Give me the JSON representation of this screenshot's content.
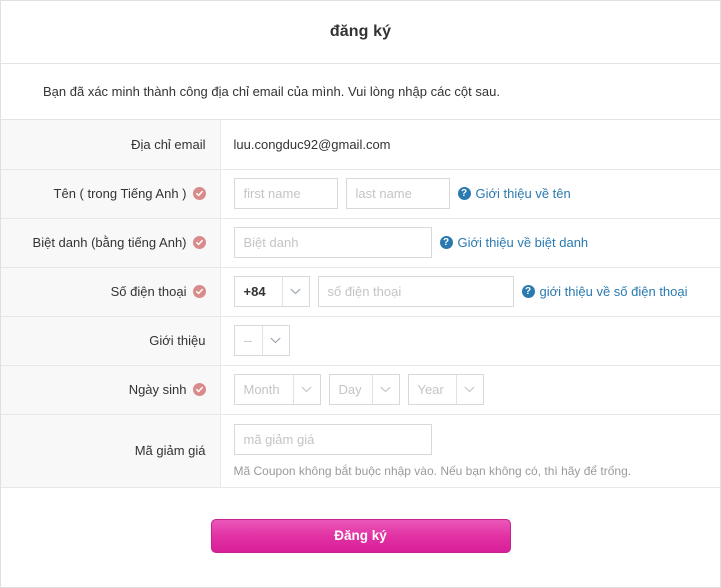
{
  "header": {
    "title": "đăng ký"
  },
  "notice": {
    "text": "Bạn đã xác minh thành công địa chỉ email của mình. Vui lòng nhập các cột sau."
  },
  "form": {
    "rows": {
      "email": {
        "label": "Địa chỉ email",
        "value": "luu.congduc92@gmail.com"
      },
      "name": {
        "label": "Tên ( trong Tiếng Anh )",
        "first_placeholder": "first name",
        "first_value": "",
        "last_placeholder": "last name",
        "last_value": "",
        "help": "Giới thiệu về tên",
        "help_icon": "question-circle-icon"
      },
      "nickname": {
        "label": "Biệt danh (bằng tiếng Anh)",
        "placeholder": "Biệt danh",
        "value": "",
        "help": "Giới thiệu về biệt danh",
        "help_icon": "question-circle-icon"
      },
      "phone": {
        "label": "Số điện thoại",
        "country_code": "+84",
        "placeholder": "số điện thoại",
        "value": "",
        "help": "giới thiệu về số điện thoại",
        "help_icon": "question-circle-icon"
      },
      "referral": {
        "label": "Giới thiệu",
        "selected": "--"
      },
      "birthday": {
        "label": "Ngày sinh",
        "month": "Month",
        "day": "Day",
        "year": "Year"
      },
      "coupon": {
        "label": "Mã giảm giá",
        "placeholder": "mã giảm giá",
        "value": "",
        "hint": "Mã Coupon không bắt buộc nhập vào. Nếu bạn không có, thì hãy để trống."
      }
    },
    "required_icon": "check-circle-icon"
  },
  "footer": {
    "submit_label": "Đăng ký"
  },
  "colors": {
    "accent": "#e231a4",
    "link": "#2a7ab0",
    "required": "#d98b8b",
    "label_bg": "#f8f8f8",
    "border": "#e8e8e8"
  }
}
